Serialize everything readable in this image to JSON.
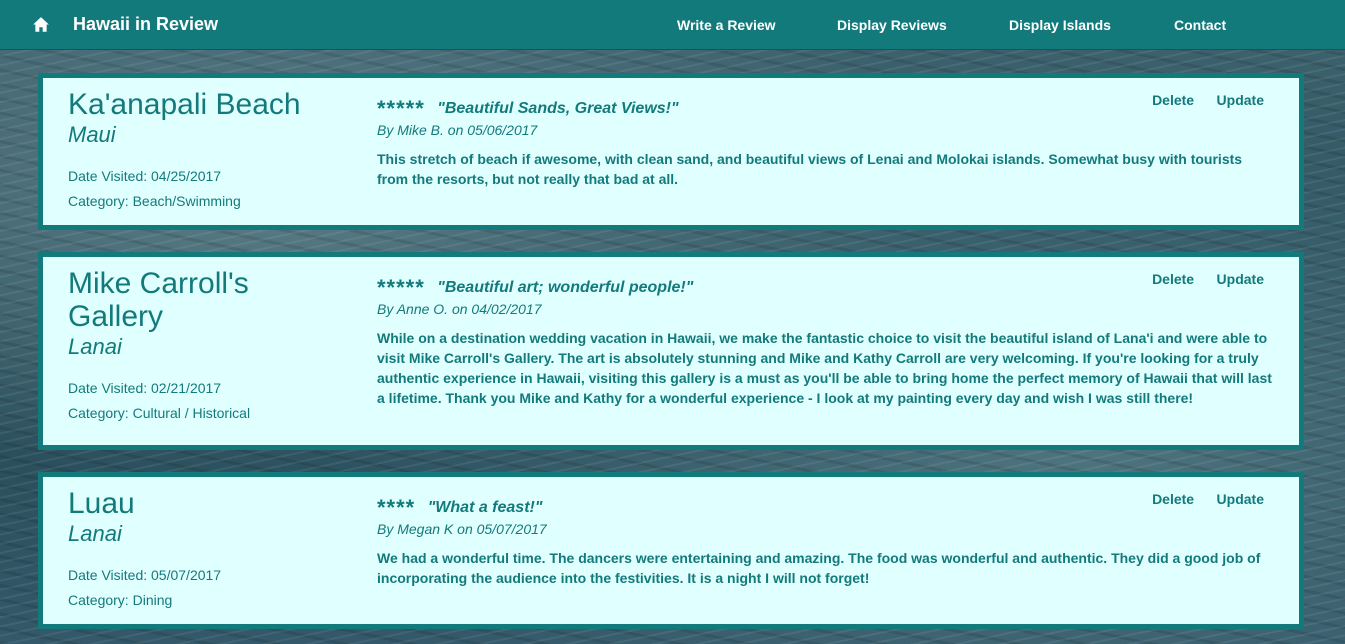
{
  "navbar": {
    "brand": "Hawaii in Review",
    "links": [
      "Write a Review",
      "Display Reviews",
      "Display Islands",
      "Contact"
    ]
  },
  "labels": {
    "date_visited": "Date Visited:",
    "category": "Category:",
    "delete": "Delete",
    "update": "Update"
  },
  "reviews": [
    {
      "place": "Ka'anapali Beach",
      "island": "Maui",
      "date_visited": "04/25/2017",
      "category": "Beach/Swimming",
      "stars": "*****",
      "rating": 5,
      "title": "\"Beautiful Sands, Great Views!\"",
      "byline": "By Mike B. on 05/06/2017",
      "body": "This stretch of beach if awesome, with clean sand, and beautiful views of Lenai and Molokai islands. Somewhat busy with tourists from the resorts, but not really that bad at all."
    },
    {
      "place": "Mike Carroll's Gallery",
      "island": "Lanai",
      "date_visited": "02/21/2017",
      "category": "Cultural / Historical",
      "stars": "*****",
      "rating": 5,
      "title": "\"Beautiful art; wonderful people!\"",
      "byline": "By Anne O. on 04/02/2017",
      "body": "While on a destination wedding vacation in Hawaii, we make the fantastic choice to visit the beautiful island of Lana'i and were able to visit Mike Carroll's Gallery. The art is absolutely stunning and Mike and Kathy Carroll are very welcoming. If you're looking for a truly authentic experience in Hawaii, visiting this gallery is a must as you'll be able to bring home the perfect memory of Hawaii that will last a lifetime. Thank you Mike and Kathy for a wonderful experience - I look at my painting every day and wish I was still there!"
    },
    {
      "place": "Luau",
      "island": "Lanai",
      "date_visited": "05/07/2017",
      "category": "Dining",
      "stars": "****",
      "rating": 4,
      "title": "\"What a feast!\"",
      "byline": "By Megan K on 05/07/2017",
      "body": "We had a wonderful time. The dancers were entertaining and amazing. The food was wonderful and authentic. They did a good job of incorporating the audience into the festivities. It is a night I will not forget!"
    }
  ],
  "colors": {
    "navbar": "#137a7c",
    "card_background": "#e0ffff",
    "card_border": "#137a7c",
    "text": "#137a7c"
  }
}
